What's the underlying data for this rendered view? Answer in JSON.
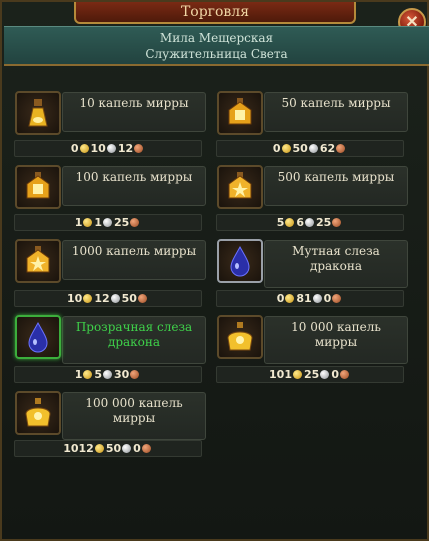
{
  "window": {
    "title": "Торговля",
    "close_icon": "close-icon"
  },
  "npc": {
    "name": "Мила Мещерская",
    "role": "Служительница Света"
  },
  "items": [
    {
      "name": "10 капель мирры",
      "icon": "potion-flask-icon",
      "color": "#e8e2cc",
      "price": {
        "gold": "0",
        "silver": "10",
        "copper": "12"
      }
    },
    {
      "name": "50 капель мирры",
      "icon": "lantern-flask-icon",
      "color": "#e8e2cc",
      "price": {
        "gold": "0",
        "silver": "50",
        "copper": "62"
      }
    },
    {
      "name": "100 капель мирры",
      "icon": "lantern-flask-icon",
      "color": "#e8e2cc",
      "price": {
        "gold": "1",
        "silver": "1",
        "copper": "25"
      }
    },
    {
      "name": "500 капель мирры",
      "icon": "star-flask-icon",
      "color": "#e8e2cc",
      "price": {
        "gold": "5",
        "silver": "6",
        "copper": "25"
      }
    },
    {
      "name": "1000 капель мирры",
      "icon": "star-flask-icon",
      "color": "#e8e2cc",
      "price": {
        "gold": "10",
        "silver": "12",
        "copper": "50"
      }
    },
    {
      "name": "Мутная слеза дракона",
      "icon": "dragon-tear-icon",
      "color": "#e8e2cc",
      "price": {
        "gold": "0",
        "silver": "81",
        "copper": "0"
      }
    },
    {
      "name": "Прозрачная слеза дракона",
      "icon": "dragon-tear-icon",
      "color": "#3fd24a",
      "price": {
        "gold": "1",
        "silver": "5",
        "copper": "30"
      }
    },
    {
      "name": "10 000 капель мирры",
      "icon": "golden-vessel-icon",
      "color": "#e8e2cc",
      "price": {
        "gold": "101",
        "silver": "25",
        "copper": "0"
      }
    },
    {
      "name": "100 000 капель мирры",
      "icon": "golden-vessel-icon",
      "color": "#e8e2cc",
      "price": {
        "gold": "1012",
        "silver": "50",
        "copper": "0"
      }
    }
  ],
  "colors": {
    "accent": "#b58a3a",
    "header": "#2f5b55",
    "rare": "#3fd24a"
  }
}
